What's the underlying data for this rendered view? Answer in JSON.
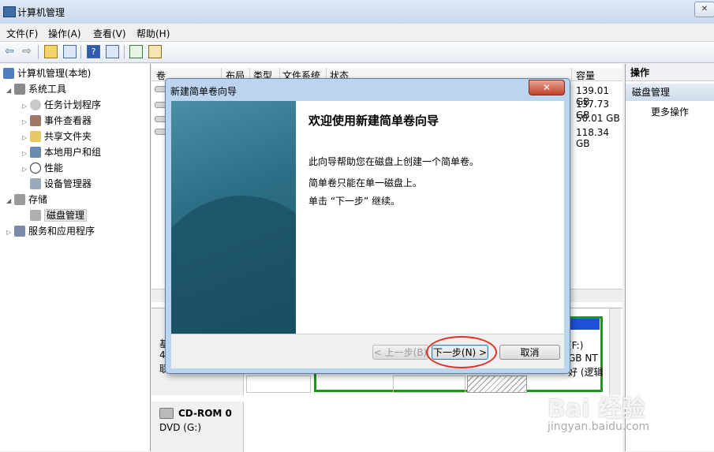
{
  "window": {
    "title": "计算机管理"
  },
  "menu": [
    "文件(F)",
    "操作(A)",
    "查看(V)",
    "帮助(H)"
  ],
  "tree": {
    "root": "计算机管理(本地)",
    "system_tools": "系统工具",
    "task_scheduler": "任务计划程序",
    "event_viewer": "事件查看器",
    "shared_folders": "共享文件夹",
    "local_users": "本地用户和组",
    "performance": "性能",
    "device_manager": "设备管理器",
    "storage": "存储",
    "disk_management": "磁盘管理",
    "services": "服务和应用程序"
  },
  "volume_list": {
    "columns": [
      "卷",
      "布局",
      "类型",
      "文件系统",
      "状态",
      "容量"
    ],
    "capacities": [
      "139.01 GB",
      "137.73 GB",
      "50.01 GB",
      "118.34 GB"
    ]
  },
  "disk_panel": {
    "partial_left": [
      "基",
      "4",
      "联"
    ],
    "partial_right": [
      "(F:)",
      "GB NT",
      "好 (逻辑"
    ],
    "cdrom_label": "CD-ROM 0",
    "cdrom_drive": "DVD (G:)"
  },
  "actions": {
    "header": "操作",
    "section": "磁盘管理",
    "more": "更多操作"
  },
  "wizard": {
    "title": "新建简单卷向导",
    "close": "✕",
    "heading": "欢迎使用新建简单卷向导",
    "p1": "此向导帮助您在磁盘上创建一个简单卷。",
    "p2": "简单卷只能在单一磁盘上。",
    "p3": "单击 “下一步” 继续。",
    "back": "< 上一步(B)",
    "next": "下一步(N) >",
    "cancel": "取消"
  },
  "watermark": {
    "brand": "Bai 经验",
    "url": "jingyan.baidu.com"
  }
}
